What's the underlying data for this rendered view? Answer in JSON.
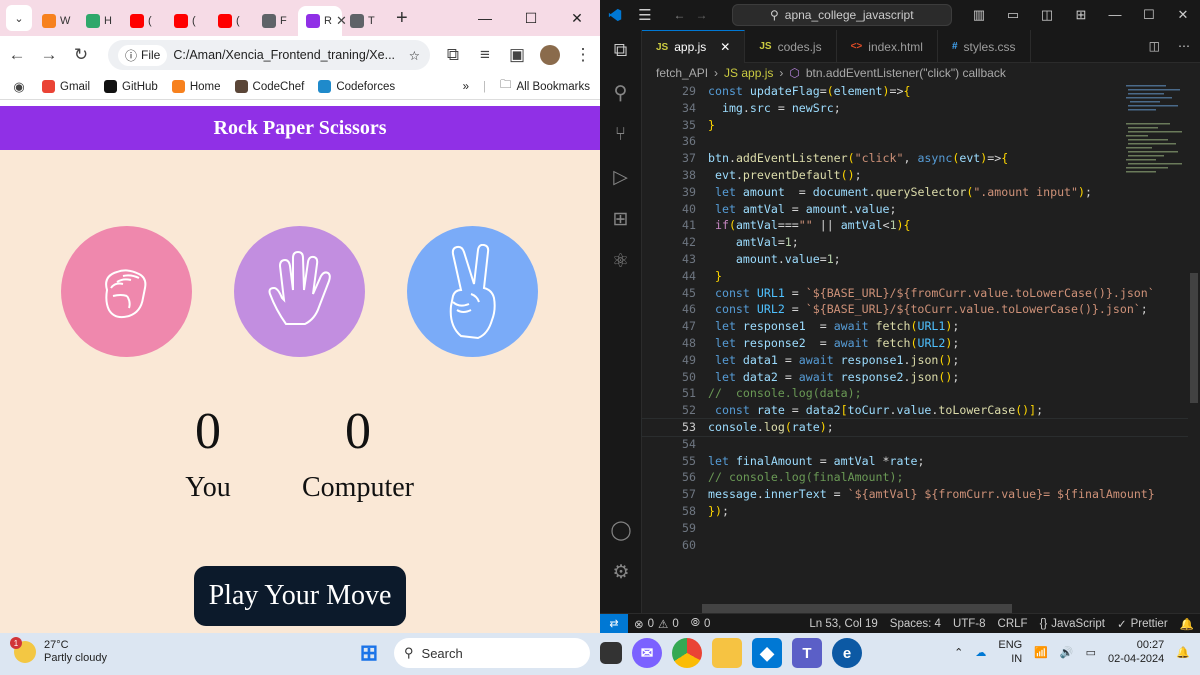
{
  "browser": {
    "tabs": [
      {
        "label": "W",
        "color": "#f7811e"
      },
      {
        "label": "H",
        "color": "#2fa86b"
      },
      {
        "label": "(",
        "color": "#ff0000"
      },
      {
        "label": "(",
        "color": "#ff0000"
      },
      {
        "label": "(",
        "color": "#ff0000"
      },
      {
        "label": "F",
        "color": "#5f6368"
      },
      {
        "label": "R",
        "color": "#9030e6"
      },
      {
        "label": "T",
        "color": "#5f6368"
      }
    ],
    "url_chip": "File",
    "url": "C:/Aman/Xencia_Frontend_traning/Xe...",
    "bookmarks": [
      {
        "label": "Gmail",
        "icon": "gmail-icon",
        "color": "#ea4335"
      },
      {
        "label": "GitHub",
        "icon": "github-icon",
        "color": "#111111"
      },
      {
        "label": "Home",
        "icon": "home-icon",
        "color": "#f7811e"
      },
      {
        "label": "CodeChef",
        "icon": "codechef-icon",
        "color": "#5b4638"
      },
      {
        "label": "Codeforces",
        "icon": "codeforces-icon",
        "color": "#1f8acb"
      }
    ],
    "all_bookmarks": "All Bookmarks"
  },
  "game": {
    "title": "Rock Paper Scissors",
    "choices": [
      {
        "name": "rock",
        "color": "#ef88ad"
      },
      {
        "name": "paper",
        "color": "#c28ee0"
      },
      {
        "name": "scissors",
        "color": "#7aabf8"
      }
    ],
    "user_score": "0",
    "user_label": "You",
    "comp_score": "0",
    "comp_label": "Computer",
    "button": "Play Your Move"
  },
  "vscode": {
    "search": "apna_college_javascript",
    "tabs": [
      {
        "icon": "JS",
        "label": "app.js",
        "active": true,
        "color": "#cbcb41"
      },
      {
        "icon": "JS",
        "label": "codes.js",
        "active": false,
        "color": "#cbcb41"
      },
      {
        "icon": "<>",
        "label": "index.html",
        "active": false,
        "color": "#e44d26"
      },
      {
        "icon": "#",
        "label": "styles.css",
        "active": false,
        "color": "#42a5f5"
      }
    ],
    "breadcrumb": [
      "fetch_API",
      "JS app.js",
      "btn.addEventListener(\"click\") callback"
    ],
    "lines": [
      {
        "n": "29",
        "t": "const updateFlag=(element)=>{"
      },
      {
        "n": "34",
        "t": "  img.src = newSrc;"
      },
      {
        "n": "35",
        "t": "}"
      },
      {
        "n": "36",
        "t": ""
      },
      {
        "n": "37",
        "t": "btn.addEventListener(\"click\", async(evt)=>{"
      },
      {
        "n": "38",
        "t": " evt.preventDefault();"
      },
      {
        "n": "39",
        "t": " let amount  = document.querySelector(\".amount input\");"
      },
      {
        "n": "40",
        "t": " let amtVal = amount.value;"
      },
      {
        "n": "41",
        "t": " if(amtVal===\"\" || amtVal<1){"
      },
      {
        "n": "42",
        "t": "    amtVal=1;"
      },
      {
        "n": "43",
        "t": "    amount.value=1;"
      },
      {
        "n": "44",
        "t": " }"
      },
      {
        "n": "45",
        "t": " const URL1 = `${BASE_URL}/${fromCurr.value.toLowerCase()}.json`"
      },
      {
        "n": "46",
        "t": " const URL2 = `${BASE_URL}/${toCurr.value.toLowerCase()}.json`;"
      },
      {
        "n": "47",
        "t": " let response1  = await fetch(URL1);"
      },
      {
        "n": "48",
        "t": " let response2  = await fetch(URL2);"
      },
      {
        "n": "49",
        "t": " let data1 = await response1.json();"
      },
      {
        "n": "50",
        "t": " let data2 = await response2.json();"
      },
      {
        "n": "51",
        "t": "//  console.log(data);"
      },
      {
        "n": "52",
        "t": " const rate = data2[toCurr.value.toLowerCase()];"
      },
      {
        "n": "53",
        "t": "console.log(rate);"
      },
      {
        "n": "54",
        "t": ""
      },
      {
        "n": "55",
        "t": "let finalAmount = amtVal *rate;"
      },
      {
        "n": "56",
        "t": "// console.log(finalAmount);"
      },
      {
        "n": "57",
        "t": "message.innerText = `${amtVal} ${fromCurr.value}= ${finalAmount}"
      },
      {
        "n": "58",
        "t": "});"
      },
      {
        "n": "59",
        "t": ""
      },
      {
        "n": "60",
        "t": ""
      }
    ],
    "current_line": "53",
    "status": {
      "problems": "0",
      "warnings": "0",
      "ports": "0",
      "position": "Ln 53, Col 19",
      "spaces": "Spaces: 4",
      "encoding": "UTF-8",
      "eol": "CRLF",
      "language": "JavaScript",
      "formatter": "Prettier"
    }
  },
  "taskbar": {
    "temp": "27°C",
    "weather": "Partly cloudy",
    "notif": "1",
    "search": "Search",
    "lang1": "ENG",
    "lang2": "IN",
    "time": "00:27",
    "date": "02-04-2024"
  }
}
